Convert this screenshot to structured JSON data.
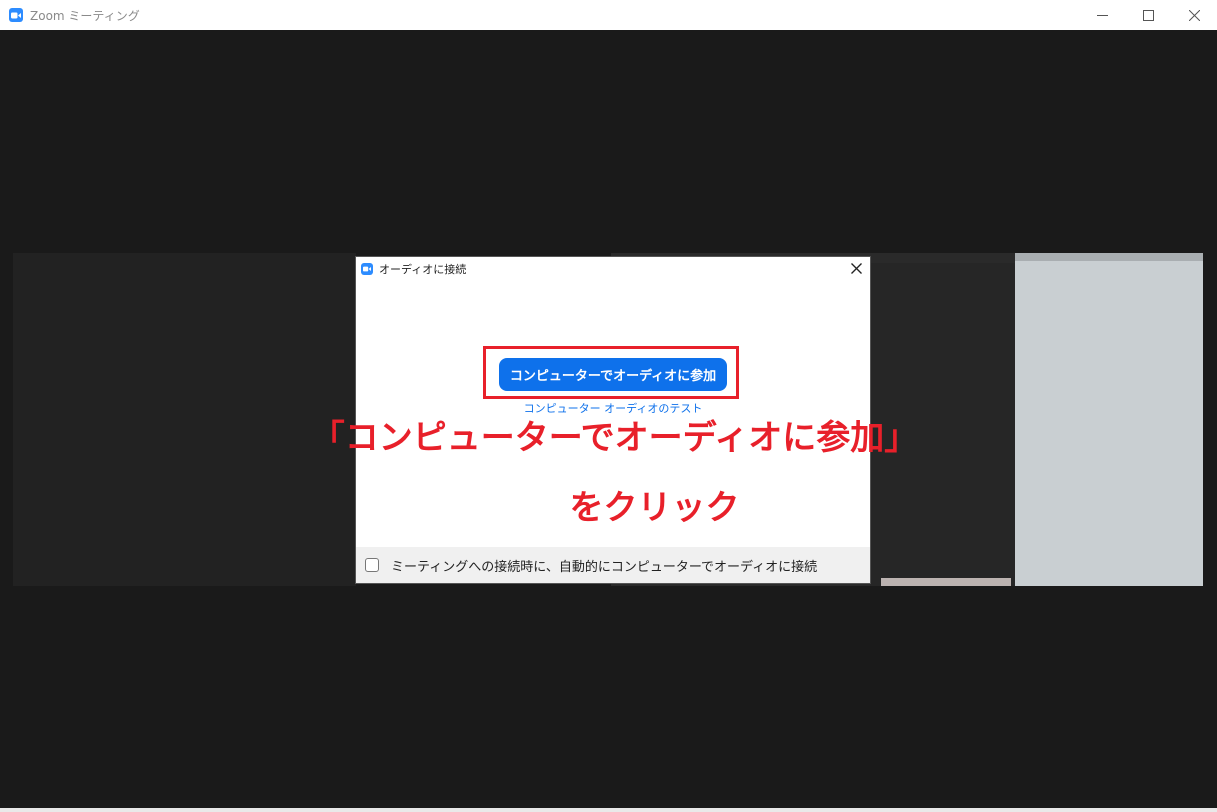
{
  "window": {
    "title": "Zoom ミーティング",
    "controls": {
      "minimize": "—",
      "maximize": "☐",
      "close": "✕"
    }
  },
  "dialog": {
    "title": "オーディオに接続",
    "close_glyph": "✕",
    "join_button_label": "コンピューターでオーディオに参加",
    "test_link_label": "コンピューター オーディオのテスト",
    "auto_join_label": "ミーティングへの接続時に、自動的にコンピューターでオーディオに接続",
    "auto_join_checked": false
  },
  "annotation": {
    "line1": "「コンピューターでオーディオに参加」",
    "line2": "をクリック",
    "color": "#e8202a"
  },
  "colors": {
    "accent": "#0e71eb",
    "zoom_brand": "#2d8cff",
    "background": "#1a1a1a"
  },
  "icons": {
    "app": "zoom-camera-icon",
    "dialog": "zoom-camera-icon",
    "close": "close-icon"
  }
}
